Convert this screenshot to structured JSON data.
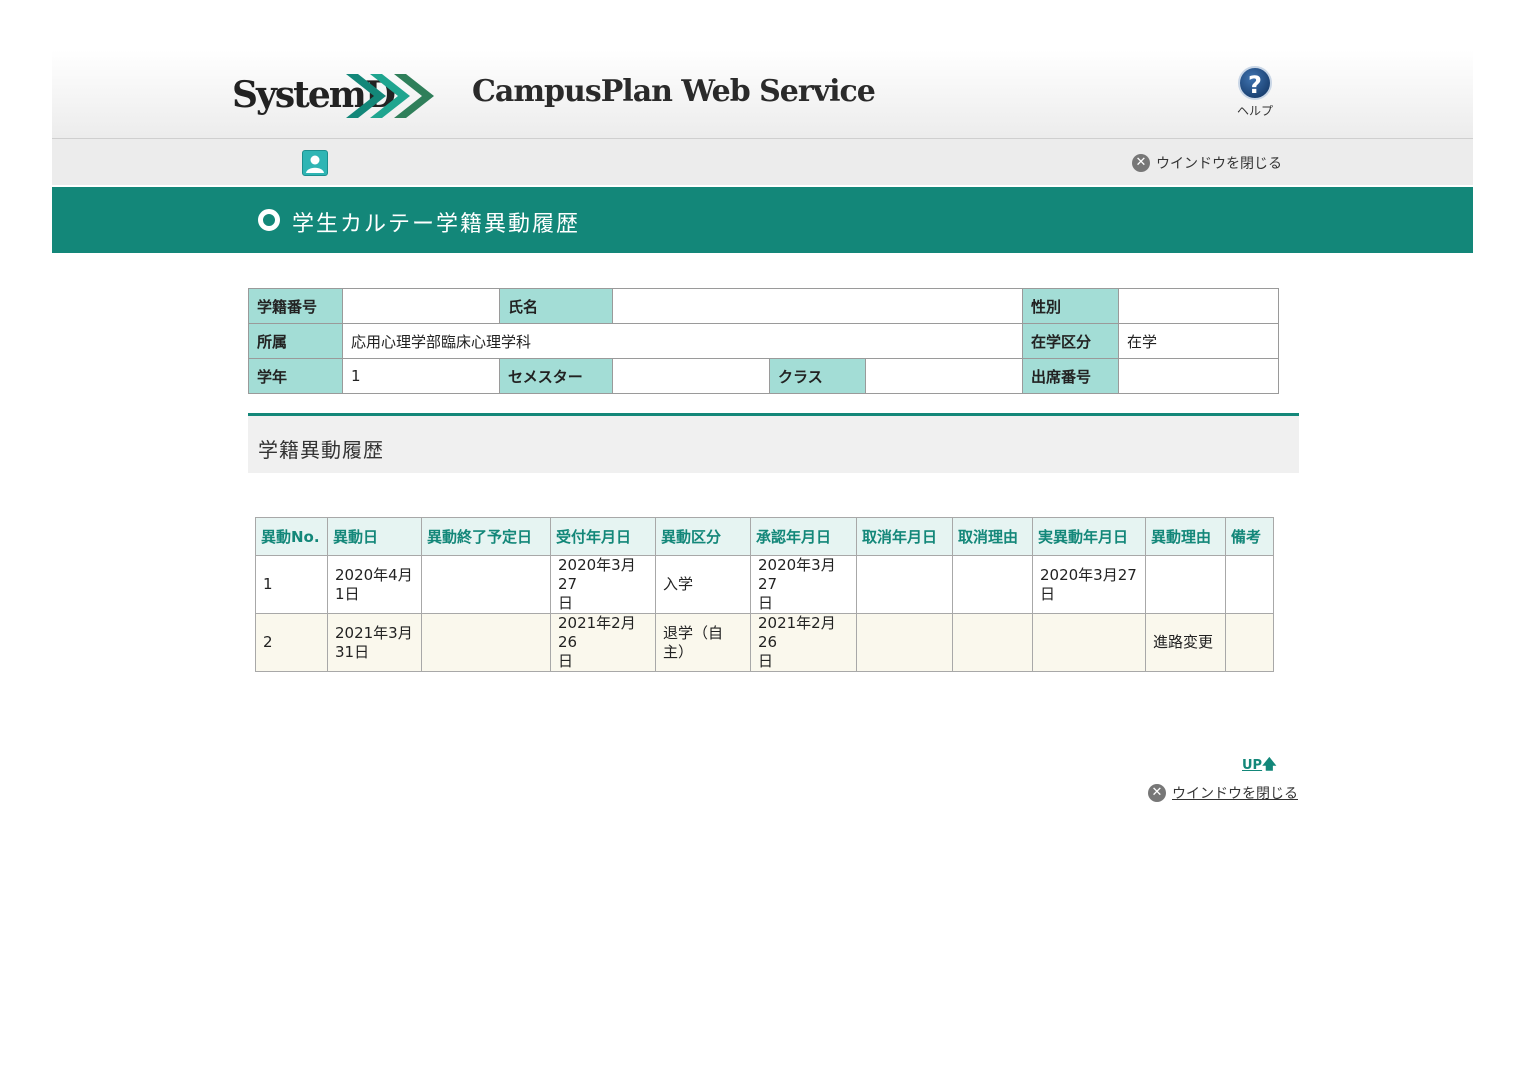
{
  "header": {
    "logo_text": "SystemD",
    "app_title": "CampusPlan Web Service",
    "help_label": "ヘルプ",
    "help_glyph": "?"
  },
  "toolbar": {
    "close_label": "ウインドウを閉じる",
    "close_glyph": "✕"
  },
  "banner": {
    "title": "学生カルテー学籍異動履歴"
  },
  "student": {
    "id_label": "学籍番号",
    "id_value": "",
    "name_label": "氏名",
    "name_value": "",
    "gender_label": "性別",
    "gender_value": "",
    "affiliation_label": "所属",
    "affiliation_value": "応用心理学部臨床心理学科",
    "status_label": "在学区分",
    "status_value": "在学",
    "year_label": "学年",
    "year_value": "1",
    "semester_label": "セメスター",
    "semester_value": "",
    "class_label": "クラス",
    "class_value": "",
    "attendance_label": "出席番号",
    "attendance_value": ""
  },
  "section": {
    "title": "学籍異動履歴"
  },
  "history": {
    "columns": [
      "異動No.",
      "異動日",
      "異動終了予定日",
      "受付年月日",
      "異動区分",
      "承認年月日",
      "取消年月日",
      "取消理由",
      "実異動年月日",
      "異動理由",
      "備考"
    ],
    "rows": [
      {
        "no": "1",
        "date_1": "2020年4月",
        "date_2": "1日",
        "end": "",
        "received_1": "2020年3月27",
        "received_2": "日",
        "kind_1": "入学",
        "kind_2": "",
        "approved_1": "2020年3月27",
        "approved_2": "日",
        "cancel_date": "",
        "cancel_reason": "",
        "actual_1": "2020年3月27",
        "actual_2": "日",
        "reason": "",
        "note": ""
      },
      {
        "no": "2",
        "date_1": "2021年3月",
        "date_2": "31日",
        "end": "",
        "received_1": "2021年2月26",
        "received_2": "日",
        "kind_1": "退学（自",
        "kind_2": "主）",
        "approved_1": "2021年2月26",
        "approved_2": "日",
        "cancel_date": "",
        "cancel_reason": "",
        "actual_1": "",
        "actual_2": "",
        "reason": "進路変更",
        "note": ""
      }
    ]
  },
  "footer": {
    "up_label": "UP",
    "up_glyph": "🡅",
    "close_label": "ウインドウを閉じる"
  },
  "colors": {
    "accent": "#138779",
    "label_bg": "#a3ddd6",
    "row_alt_bg": "#faf8ed"
  }
}
